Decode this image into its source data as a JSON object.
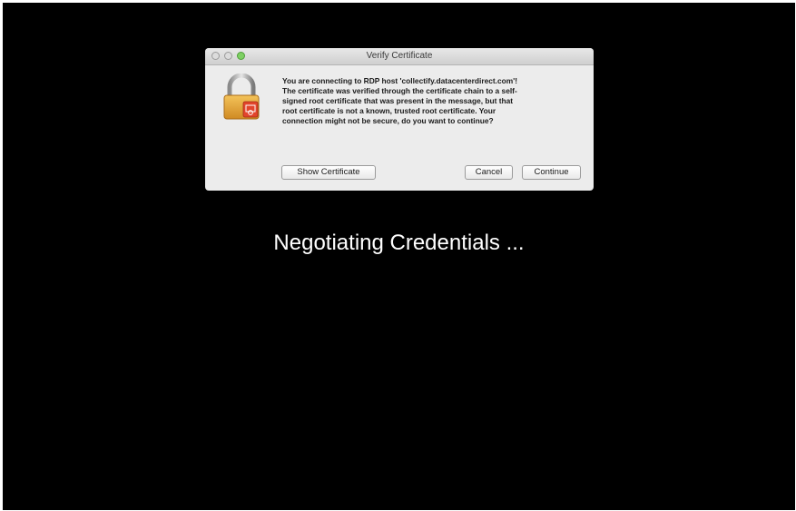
{
  "dialog": {
    "title": "Verify Certificate",
    "message": "You are connecting to RDP host 'collectify.datacenterdirect.com'!\nThe certificate was verified through the certificate chain to a self-\nsigned root certificate that was present in the message, but that\nroot certificate is not a known, trusted root certificate. Your\nconnection might not be secure, do you want to continue?",
    "show_certificate_label": "Show Certificate",
    "cancel_label": "Cancel",
    "continue_label": "Continue",
    "icon": "padlock-certificate-icon"
  },
  "status_text": "Negotiating Credentials ...",
  "colors": {
    "background": "#000000",
    "dialog": "#ececec",
    "zoom_button": "#7ed063",
    "lock_gold": "#e8a33a",
    "certificate_red": "#e2452c"
  }
}
